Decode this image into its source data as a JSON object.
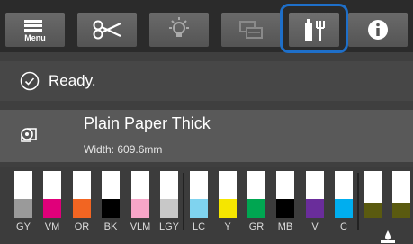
{
  "toolbar": {
    "menu_label": "Menu",
    "buttons": [
      "menu-icon",
      "scissors-icon",
      "light-bulb-icon",
      "print-queue-icon",
      "maintenance-icon",
      "info-icon"
    ],
    "selected": "maintenance-icon",
    "accent": "#1e6fc9"
  },
  "status": {
    "text": "Ready.",
    "icon": "check-circle-icon"
  },
  "paper": {
    "icon": "paper-roll-icon",
    "name": "Plain Paper Thick",
    "width": "Width: 609.6mm"
  },
  "inks": [
    {
      "label": "GY",
      "color": "#9a9a9a",
      "level": 0.4
    },
    {
      "label": "VM",
      "color": "#e0007a",
      "level": 0.4
    },
    {
      "label": "OR",
      "color": "#f26522",
      "level": 0.4
    },
    {
      "label": "BK",
      "color": "#000000",
      "level": 0.4
    },
    {
      "label": "VLM",
      "color": "#f7a6c8",
      "level": 0.4
    },
    {
      "label": "LGY",
      "color": "#c8c8c8",
      "level": 0.4
    },
    {
      "label": "LC",
      "color": "#7fd3ef",
      "level": 0.4
    },
    {
      "label": "Y",
      "color": "#f5e600",
      "level": 0.4
    },
    {
      "label": "GR",
      "color": "#00a651",
      "level": 0.4
    },
    {
      "label": "MB",
      "color": "#000000",
      "level": 0.4
    },
    {
      "label": "V",
      "color": "#6a2d9b",
      "level": 0.4
    },
    {
      "label": "C",
      "color": "#00aeef",
      "level": 0.4
    },
    {
      "label": "",
      "color": "#5a5a10",
      "level": 0.3
    },
    {
      "label": "",
      "color": "#5a5a10",
      "level": 0.3
    }
  ]
}
